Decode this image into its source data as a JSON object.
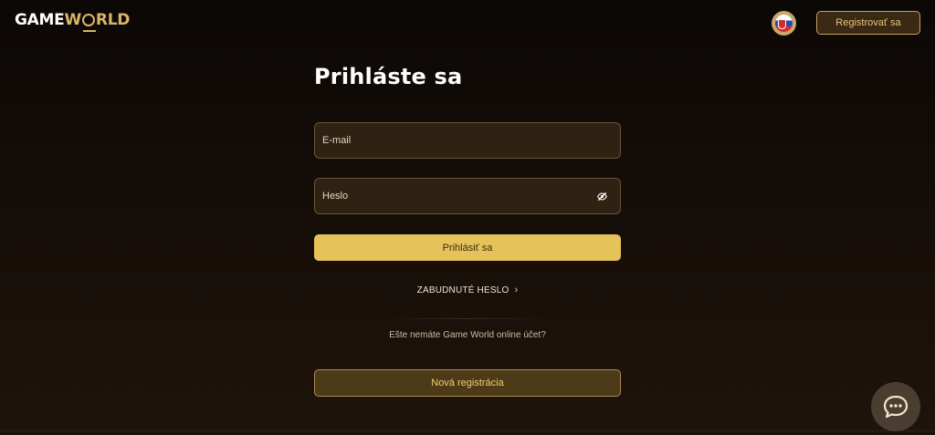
{
  "header": {
    "logo_game": "GAME",
    "logo_world_w": "W",
    "logo_world_rest": "RLD",
    "register_label": "Registrovať sa",
    "flag_icon": "slovakia-flag-icon"
  },
  "login": {
    "title": "Prihláste sa",
    "email_placeholder": "E-mail",
    "password_placeholder": "Heslo",
    "password_toggle_icon": "eye-slash-icon",
    "submit_label": "Prihlásiť sa",
    "forgot_label": "ZABUDNUTÉ HESLO",
    "no_account_text": "Ešte nemáte Game World online účet?",
    "new_registration_label": "Nová registrácia"
  },
  "chat": {
    "icon": "chat-bubble-icon"
  },
  "colors": {
    "accent": "#e6c35a",
    "accent_border": "#c7a25a",
    "background": "#150d08",
    "field_bg": "#2f2213"
  }
}
